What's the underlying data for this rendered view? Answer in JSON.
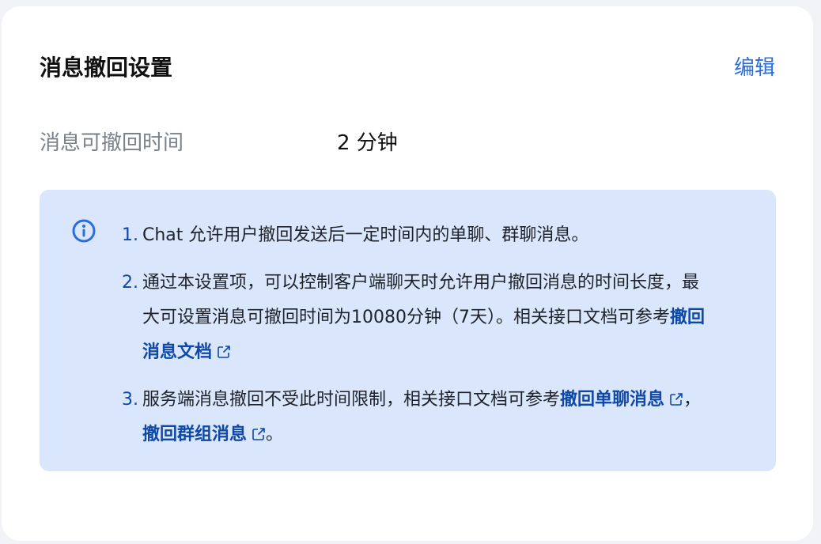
{
  "card": {
    "title": "消息撤回设置",
    "edit_label": "编辑"
  },
  "setting": {
    "label": "消息可撤回时间",
    "value": "2 分钟"
  },
  "notice": {
    "icon": "info-circle-icon",
    "items": [
      {
        "number": "1.",
        "text": "Chat 允许用户撤回发送后一定时间内的单聊、群聊消息。"
      },
      {
        "number": "2.",
        "text": "通过本设置项，可以控制客户端聊天时允许用户撤回消息的时间长度，最大可设置消息可撤回时间为10080分钟（7天）。相关接口文档可参考",
        "link": "撤回消息文档"
      },
      {
        "number": "3.",
        "text": "服务端消息撤回不受此时间限制，相关接口文档可参考",
        "link1": "撤回单聊消息",
        "separator": "，",
        "link2": "撤回群组消息",
        "end": "。"
      }
    ]
  },
  "colors": {
    "accent": "#2a6de0",
    "link": "#0e48a8",
    "notice_bg": "#dae6fb",
    "muted_text": "#7a818b"
  }
}
